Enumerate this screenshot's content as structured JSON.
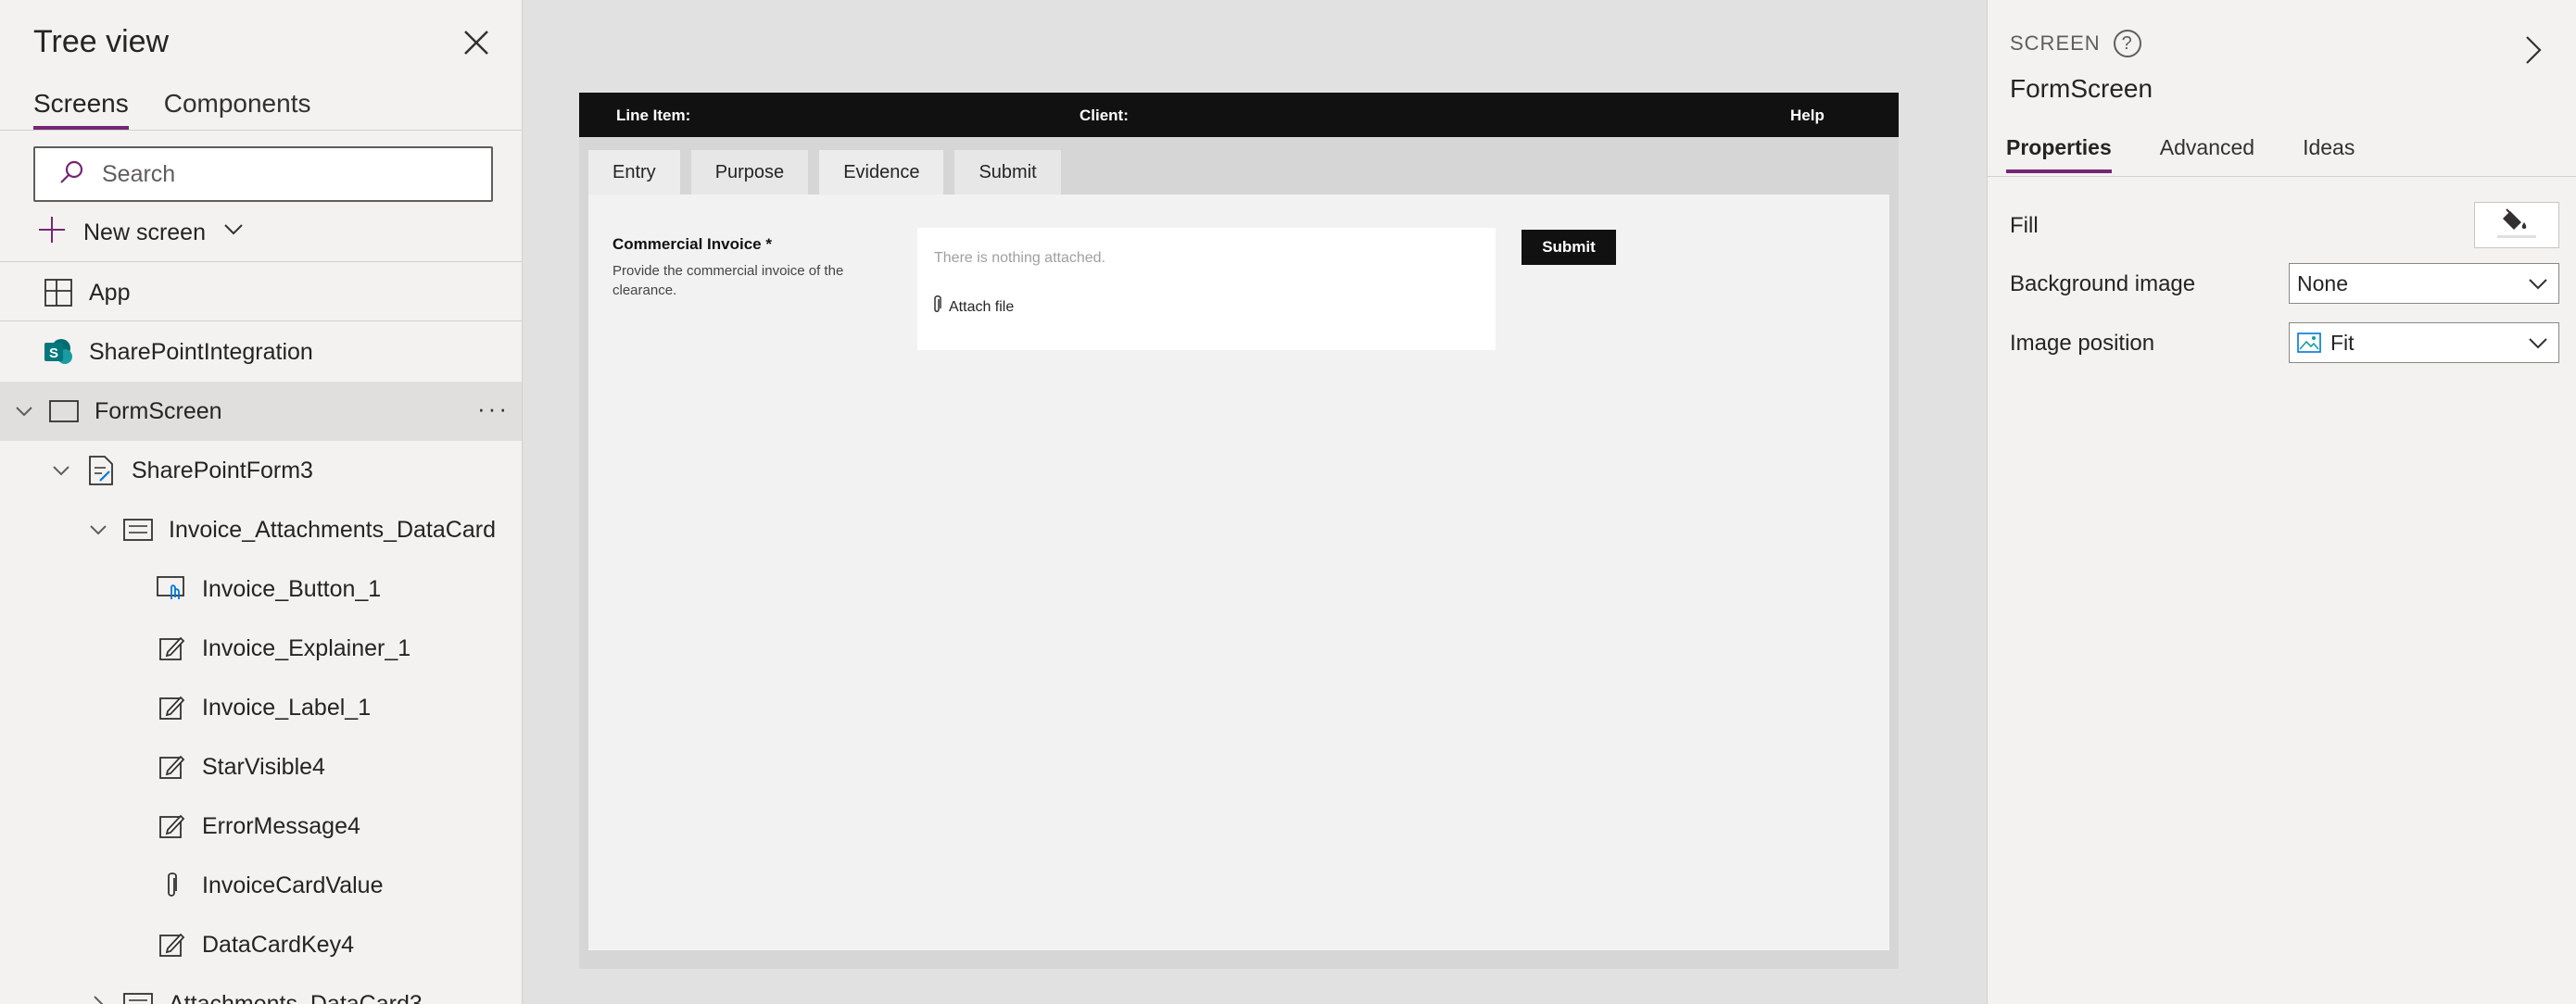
{
  "tree": {
    "title": "Tree view",
    "tabs": [
      "Screens",
      "Components"
    ],
    "search_placeholder": "Search",
    "new_screen_label": "New screen",
    "items": [
      {
        "label": "App"
      },
      {
        "label": "SharePointIntegration"
      },
      {
        "label": "FormScreen",
        "selected": true
      },
      {
        "label": "SharePointForm3"
      },
      {
        "label": "Invoice_Attachments_DataCard"
      },
      {
        "label": "Invoice_Button_1"
      },
      {
        "label": "Invoice_Explainer_1"
      },
      {
        "label": "Invoice_Label_1"
      },
      {
        "label": "StarVisible4"
      },
      {
        "label": "ErrorMessage4"
      },
      {
        "label": "InvoiceCardValue"
      },
      {
        "label": "DataCardKey4"
      },
      {
        "label": "Attachments_DataCard3"
      }
    ]
  },
  "canvas": {
    "header": {
      "line_item": "Line Item:",
      "client": "Client:",
      "help": "Help"
    },
    "tabs": [
      "Entry",
      "Purpose",
      "Evidence",
      "Submit"
    ],
    "field": {
      "label": "Commercial Invoice *",
      "explainer": "Provide the commercial invoice of the clearance.",
      "empty_text": "There is nothing attached.",
      "attach_label": "Attach file"
    },
    "submit_label": "Submit"
  },
  "props": {
    "kind": "SCREEN",
    "name": "FormScreen",
    "tabs": [
      "Properties",
      "Advanced",
      "Ideas"
    ],
    "fill_label": "Fill",
    "background_image_label": "Background image",
    "background_image_value": "None",
    "image_position_label": "Image position",
    "image_position_value": "Fit"
  },
  "colors": {
    "accent": "#742774",
    "header": "#111111"
  }
}
